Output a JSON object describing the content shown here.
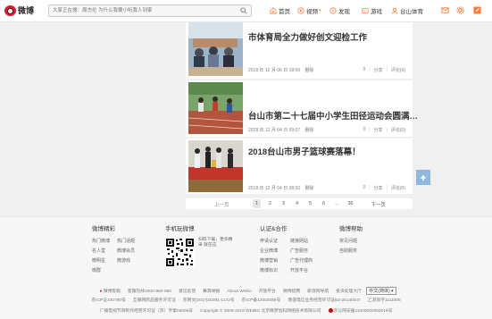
{
  "header": {
    "logo_text": "微博",
    "search_placeholder": "大家正在搜：周杰伦 为什么我要小听我人到家",
    "nav": [
      {
        "label": "首页"
      },
      {
        "label": "视频"
      },
      {
        "label": "发现"
      },
      {
        "label": "游戏"
      },
      {
        "label": "台山体育"
      }
    ],
    "brand_color": "#fa7d3c"
  },
  "feed": [
    {
      "title": "市体育局全力做好创文迎检工作",
      "meta_date": "2018 年 12 月 06 日 18:56",
      "meta_delete": "删除",
      "share": "分享",
      "comment": "评论(0)",
      "read": "0"
    },
    {
      "title": "台山市第二十七届中小学生田径运动会圆满…",
      "meta_date": "2018 年 12 月 04 日 09:07",
      "meta_delete": "删除",
      "share": "分享",
      "comment": "评论(0)",
      "read": "0"
    },
    {
      "title": "2018台山市男子篮球赛落幕！",
      "meta_date": "2018 年 12 月 04 日 08:50",
      "meta_delete": "删除",
      "share": "分享",
      "comment": "评论(0)",
      "read": "0"
    }
  ],
  "pager": {
    "prev": "上一页",
    "pages": [
      "1",
      "2",
      "3",
      "4",
      "5",
      "6",
      "...",
      "36"
    ],
    "current": "1",
    "next": "下一页"
  },
  "footer": {
    "col1": {
      "title": "微博精彩",
      "items": [
        "热门微博",
        "热门话题",
        "名人堂",
        "微博会员",
        "微明星",
        "微游戏",
        "微群"
      ]
    },
    "col2": {
      "title": "手机玩微博",
      "qr_text": "扫码下载，更多精采 就在这"
    },
    "col3": {
      "title": "认证&合作",
      "items": [
        "申请认证",
        "链接网站",
        "企业微博",
        "广告服务",
        "微博营销",
        "广告代理商",
        "微博标识",
        "开放平台"
      ]
    },
    "col4": {
      "title": "微博帮助",
      "items": [
        "常见问题",
        "自助服务"
      ]
    },
    "line1": [
      "微博客服",
      "客服热线4000-960-960",
      "意见反馈",
      "舞弊举报",
      "About Weibo",
      "开放平台",
      "微博招聘",
      "新浪网导航",
      "投诉处理大厅"
    ],
    "lang": "中文(简体)",
    "line2": [
      "京ICP证100780号",
      "互联网药品服务许可证",
      "京网文[2017]10291-1172号",
      "京ICP备12002058号",
      "增值电信业务经营许可证B2-20140447",
      "乙测资字1111005"
    ],
    "line3": [
      "广播电视节目制作经营许可证（京）字第04005号",
      "Copyright © 2009-2019 WEIBO 北京微梦创科网络技术有限公司",
      "京公网安备11000002000019号"
    ]
  }
}
